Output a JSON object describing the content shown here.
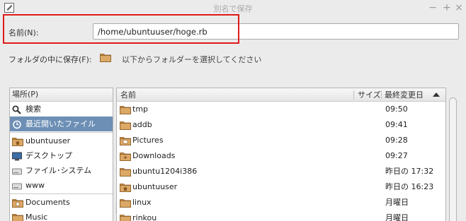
{
  "window": {
    "title": "別名で保存",
    "minimize": "−",
    "maximize": "+",
    "close": "×"
  },
  "name_row": {
    "label": "名前(N):",
    "value": "/home/ubuntuuser/hoge.rb"
  },
  "folder_row": {
    "label": "フォルダの中に保存(F):",
    "prompt": "以下からフォルダーを選択してください"
  },
  "places": {
    "header": "場所(P)",
    "items": [
      {
        "label": "検索",
        "icon": "search-icon"
      },
      {
        "label": "最近開いたファイル",
        "icon": "recent-icon",
        "selected": true
      },
      {
        "label": "ubuntuuser",
        "icon": "home-folder-icon"
      },
      {
        "label": "デスクトップ",
        "icon": "desktop-icon"
      },
      {
        "label": "ファイル･システム",
        "icon": "drive-icon"
      },
      {
        "label": "www",
        "icon": "drive-icon"
      },
      {
        "label": "Documents",
        "icon": "documents-folder-icon"
      },
      {
        "label": "Music",
        "icon": "music-folder-icon"
      }
    ]
  },
  "files": {
    "headers": {
      "name": "名前",
      "size": "サイズ",
      "modified": "最終変更日"
    },
    "sort": "ascending",
    "rows": [
      {
        "name": "tmp",
        "modified": "09:50",
        "icon": "folder-icon"
      },
      {
        "name": "addb",
        "modified": "09:41",
        "icon": "folder-icon"
      },
      {
        "name": "Pictures",
        "modified": "09:28",
        "icon": "pictures-folder-icon"
      },
      {
        "name": "Downloads",
        "modified": "09:27",
        "icon": "downloads-folder-icon"
      },
      {
        "name": "ubuntu1204i386",
        "modified": "昨日の 17:32",
        "icon": "folder-icon"
      },
      {
        "name": "ubuntuuser",
        "modified": "昨日の 16:23",
        "icon": "home-folder-icon"
      },
      {
        "name": "linux",
        "modified": "月曜日",
        "icon": "folder-icon"
      },
      {
        "name": "rinkou",
        "modified": "月曜日",
        "icon": "folder-icon"
      }
    ]
  },
  "colors": {
    "selection": "#6d8fb5",
    "folder": "#d8a05a",
    "highlight_box": "#e01a1a"
  }
}
